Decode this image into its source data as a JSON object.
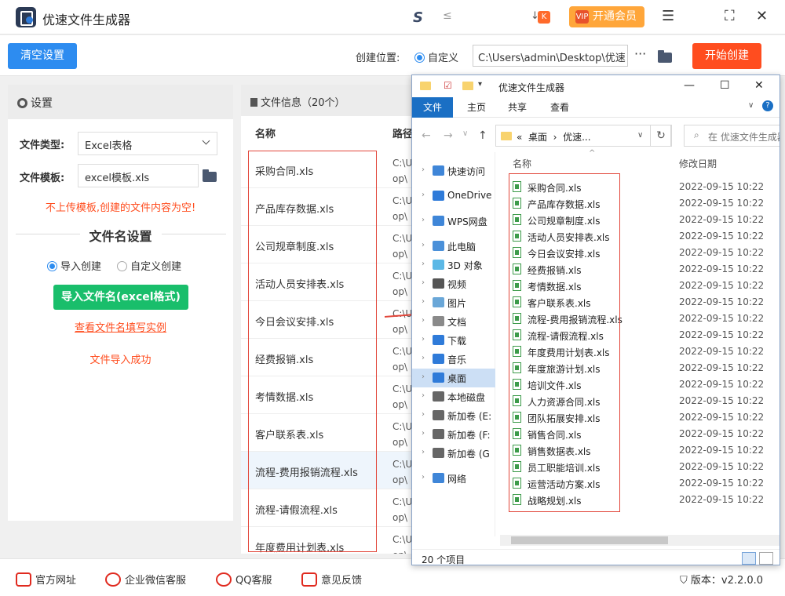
{
  "app": {
    "title": "优速文件生成器",
    "vip_label": "开通会员",
    "vip_badge": "VIP",
    "speed_mark": "S"
  },
  "toolbar": {
    "clear_label": "清空设置",
    "location_label": "创建位置:",
    "custom_label": "自定义",
    "path_value": "C:\\Users\\admin\\Desktop\\优速",
    "more_label": "···",
    "start_label": "开始创建"
  },
  "settings": {
    "header": "设置",
    "file_type_label": "文件类型:",
    "file_type_value": "Excel表格",
    "template_label": "文件模板:",
    "template_value": "excel模板.xls",
    "warning": "不上传模板,创建的文件内容为空!",
    "section_title": "文件名设置",
    "mode_import": "导入创建",
    "mode_custom": "自定义创建",
    "import_button": "导入文件名(excel格式)",
    "example_link": "查看文件名填写实例",
    "import_status": "文件导入成功"
  },
  "fileinfo": {
    "header": "文件信息（20个）",
    "col_name": "名称",
    "col_path": "路径",
    "rows": [
      {
        "name": "采购合同.xls",
        "p1": "C:\\U",
        "p2": "op\\"
      },
      {
        "name": "产品库存数据.xls",
        "p1": "C:\\U",
        "p2": "op\\"
      },
      {
        "name": "公司规章制度.xls",
        "p1": "C:\\U",
        "p2": "op\\"
      },
      {
        "name": "活动人员安排表.xls",
        "p1": "C:\\U",
        "p2": "op\\"
      },
      {
        "name": "今日会议安排.xls",
        "p1": "C:\\U",
        "p2": "op\\"
      },
      {
        "name": "经费报销.xls",
        "p1": "C:\\U",
        "p2": "op\\"
      },
      {
        "name": "考情数据.xls",
        "p1": "C:\\U",
        "p2": "op\\"
      },
      {
        "name": "客户联系表.xls",
        "p1": "C:\\U",
        "p2": "op\\"
      },
      {
        "name": "流程-费用报销流程.xls",
        "p1": "C:\\U",
        "p2": "op\\"
      },
      {
        "name": "流程-请假流程.xls",
        "p1": "C:\\U",
        "p2": "op\\"
      },
      {
        "name": "年度费用计划表.xls",
        "p1": "C:\\U",
        "p2": "op\\"
      }
    ]
  },
  "footer": {
    "website": "官方网址",
    "wechat": "企业微信客服",
    "qq": "QQ客服",
    "feedback": "意见反馈",
    "version_label": "版本：",
    "version": "v2.2.0.0"
  },
  "explorer": {
    "title": "优速文件生成器",
    "ribbon": [
      "文件",
      "主页",
      "共享",
      "查看"
    ],
    "address_prefix": "«",
    "address_desktop": "桌面",
    "address_sep": "›",
    "address_current": "优速...",
    "search_placeholder": "在 优速文件生成器",
    "col_name": "名称",
    "col_date": "修改日期",
    "nav": [
      {
        "label": "快速访问",
        "color": "#3f86d8"
      },
      {
        "label": "OneDrive",
        "color": "#2f7bd9"
      },
      {
        "label": "WPS网盘",
        "color": "#3f86d8"
      },
      {
        "label": "此电脑",
        "color": "#4a90d9"
      },
      {
        "label": "3D 对象",
        "color": "#5bb8e6"
      },
      {
        "label": "视频",
        "color": "#555555"
      },
      {
        "label": "图片",
        "color": "#6aa7d8"
      },
      {
        "label": "文档",
        "color": "#8a8a8a"
      },
      {
        "label": "下载",
        "color": "#2f7bd9"
      },
      {
        "label": "音乐",
        "color": "#2f7bd9"
      },
      {
        "label": "桌面",
        "color": "#2f7bd9"
      },
      {
        "label": "本地磁盘",
        "color": "#666666"
      },
      {
        "label": "新加卷 (E:",
        "color": "#666666"
      },
      {
        "label": "新加卷 (F:",
        "color": "#666666"
      },
      {
        "label": "新加卷 (G",
        "color": "#666666"
      },
      {
        "label": "网络",
        "color": "#3f86d8"
      }
    ],
    "files": [
      {
        "name": "采购合同.xls",
        "date": "2022-09-15 10:22"
      },
      {
        "name": "产品库存数据.xls",
        "date": "2022-09-15 10:22"
      },
      {
        "name": "公司规章制度.xls",
        "date": "2022-09-15 10:22"
      },
      {
        "name": "活动人员安排表.xls",
        "date": "2022-09-15 10:22"
      },
      {
        "name": "今日会议安排.xls",
        "date": "2022-09-15 10:22"
      },
      {
        "name": "经费报销.xls",
        "date": "2022-09-15 10:22"
      },
      {
        "name": "考情数据.xls",
        "date": "2022-09-15 10:22"
      },
      {
        "name": "客户联系表.xls",
        "date": "2022-09-15 10:22"
      },
      {
        "name": "流程-费用报销流程.xls",
        "date": "2022-09-15 10:22"
      },
      {
        "name": "流程-请假流程.xls",
        "date": "2022-09-15 10:22"
      },
      {
        "name": "年度费用计划表.xls",
        "date": "2022-09-15 10:22"
      },
      {
        "name": "年度旅游计划.xls",
        "date": "2022-09-15 10:22"
      },
      {
        "name": "培训文件.xls",
        "date": "2022-09-15 10:22"
      },
      {
        "name": "人力资源合同.xls",
        "date": "2022-09-15 10:22"
      },
      {
        "name": "团队拓展安排.xls",
        "date": "2022-09-15 10:22"
      },
      {
        "name": "销售合同.xls",
        "date": "2022-09-15 10:22"
      },
      {
        "name": "销售数据表.xls",
        "date": "2022-09-15 10:22"
      },
      {
        "name": "员工职能培训.xls",
        "date": "2022-09-15 10:22"
      },
      {
        "name": "运营活动方案.xls",
        "date": "2022-09-15 10:22"
      },
      {
        "name": "战略规划.xls",
        "date": "2022-09-15 10:22"
      }
    ],
    "status": "20 个项目"
  }
}
